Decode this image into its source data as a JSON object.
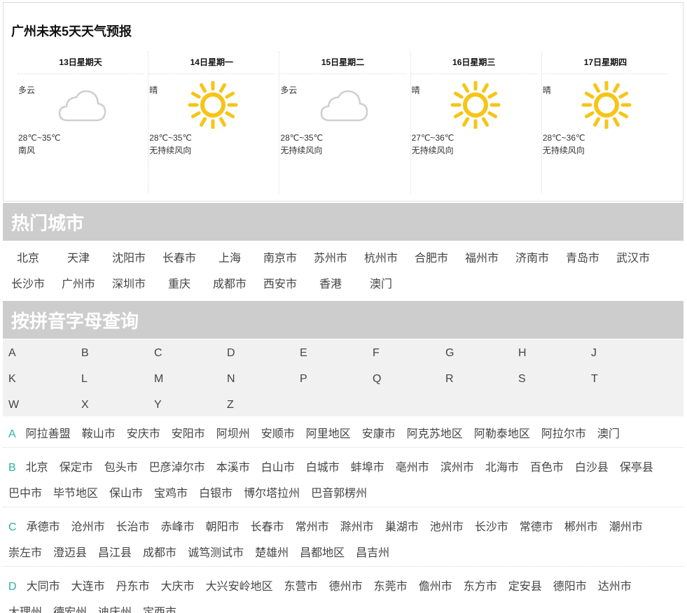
{
  "forecast": {
    "title": "广州未来5天天气预报",
    "days": [
      {
        "date": "13日星期天",
        "condition": "多云",
        "icon": "cloud-icon",
        "temp": "28℃~35℃",
        "wind": "南风"
      },
      {
        "date": "14日星期一",
        "condition": "晴",
        "icon": "sun-icon",
        "temp": "28℃~35℃",
        "wind": "无持续风向"
      },
      {
        "date": "15日星期二",
        "condition": "多云",
        "icon": "cloud-icon",
        "temp": "28℃~35℃",
        "wind": "无持续风向"
      },
      {
        "date": "16日星期三",
        "condition": "晴",
        "icon": "sun-icon",
        "temp": "27℃~36℃",
        "wind": "无持续风向"
      },
      {
        "date": "17日星期四",
        "condition": "晴",
        "icon": "sun-icon",
        "temp": "28℃~36℃",
        "wind": "无持续风向"
      }
    ]
  },
  "hot_cities": {
    "title": "热门城市",
    "rows": [
      [
        "北京",
        "天津",
        "沈阳市",
        "长春市",
        "上海",
        "南京市",
        "苏州市",
        "杭州市",
        "合肥市",
        "福州市",
        "济南市",
        "青岛市",
        "武汉市"
      ],
      [
        "长沙市",
        "广州市",
        "深圳市",
        "重庆",
        "成都市",
        "西安市",
        "香港",
        "澳门"
      ]
    ]
  },
  "pinyin": {
    "title": "按拼音字母查询",
    "rows": [
      [
        "A",
        "B",
        "C",
        "D",
        "E",
        "F",
        "G",
        "H",
        "J"
      ],
      [
        "K",
        "L",
        "M",
        "N",
        "P",
        "Q",
        "R",
        "S",
        "T"
      ],
      [
        "W",
        "X",
        "Y",
        "Z"
      ]
    ]
  },
  "groups": [
    {
      "letter": "A",
      "lines": [
        [
          "阿拉善盟",
          "鞍山市",
          "安庆市",
          "安阳市",
          "阿坝州",
          "安顺市",
          "阿里地区",
          "安康市",
          "阿克苏地区",
          "阿勒泰地区",
          "阿拉尔市",
          "澳门"
        ]
      ]
    },
    {
      "letter": "B",
      "lines": [
        [
          "北京",
          "保定市",
          "包头市",
          "巴彦淖尔市",
          "本溪市",
          "白山市",
          "白城市",
          "蚌埠市",
          "亳州市",
          "滨州市",
          "北海市",
          "百色市",
          "白沙县",
          "保亭县"
        ],
        [
          "巴中市",
          "毕节地区",
          "保山市",
          "宝鸡市",
          "白银市",
          "博尔塔拉州",
          "巴音郭楞州"
        ]
      ]
    },
    {
      "letter": "C",
      "lines": [
        [
          "承德市",
          "沧州市",
          "长治市",
          "赤峰市",
          "朝阳市",
          "长春市",
          "常州市",
          "滁州市",
          "巢湖市",
          "池州市",
          "长沙市",
          "常德市",
          "郴州市",
          "潮州市"
        ],
        [
          "崇左市",
          "澄迈县",
          "昌江县",
          "成都市",
          "诚笃测试市",
          "楚雄州",
          "昌都地区",
          "昌吉州"
        ]
      ]
    },
    {
      "letter": "D",
      "lines": [
        [
          "大同市",
          "大连市",
          "丹东市",
          "大庆市",
          "大兴安岭地区",
          "东营市",
          "德州市",
          "东莞市",
          "儋州市",
          "东方市",
          "定安县",
          "德阳市",
          "达州市"
        ],
        [
          "大理州",
          "德宏州",
          "迪庆州",
          "定西市"
        ]
      ]
    }
  ]
}
